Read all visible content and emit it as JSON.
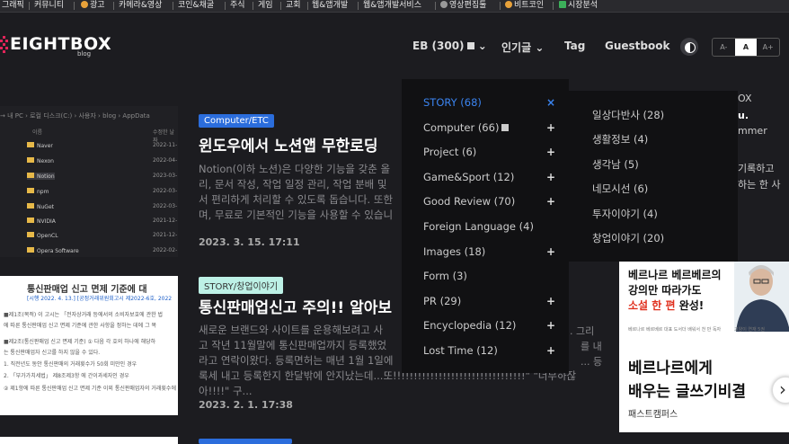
{
  "topbar": {
    "items": [
      "그래픽",
      "커뮤니티",
      "광고",
      "카메라&영상",
      "코인&채굴",
      "주식",
      "게임",
      "교회",
      "웹&앱개발",
      "웹&앱개발서비스",
      "영상편집툴",
      "비트코인",
      "시장분석"
    ]
  },
  "header": {
    "logo": "EIGHTBOX",
    "logo_sub": "blog",
    "nav": {
      "eb": "EB (300)",
      "popular": "인기글",
      "tag": "Tag",
      "guestbook": "Guestbook"
    },
    "font_size": [
      "A-",
      "A",
      "A+"
    ]
  },
  "thumb1": {
    "path": "→ 내 PC › 로컬 디스크(C:) › 사용자 › blog › AppData",
    "col_name": "이름",
    "col_date": "수정한 날짜",
    "folders": [
      {
        "name": "Naver",
        "date": "2022-11-"
      },
      {
        "name": "Nexon",
        "date": "2022-04-"
      },
      {
        "name": "Notion",
        "date": "2023-03-"
      },
      {
        "name": "npm",
        "date": "2022-03-"
      },
      {
        "name": "NuGet",
        "date": "2022-03-"
      },
      {
        "name": "NVIDIA",
        "date": "2021-12-"
      },
      {
        "name": "OpenCL",
        "date": "2021-12-"
      },
      {
        "name": "Opera Software",
        "date": "2022-02-"
      }
    ]
  },
  "thumb2": {
    "title": "통신판매업 신고 면제 기준에 대",
    "subtitle": "[시행 2022. 4. 13.] [공정거래위원회고시 제2022-6호, 2022",
    "lines": [
      "■제1조(목적) 이 고시는 「전자상거래 등에서의 소비자보호에 관한 법",
      "에 따른 통신판매업 신고 면제 기준에 관한 사항을 정하는 데에 그 목",
      "■제2조(통신판매업 신고 면제 기준) ① 다음 각 호의 하나에 해당하",
      "는 통신판매업자 신고를 하지 않을 수 있다.",
      "1. 직전년도 동안 통신판매의 거래횟수가 50회 미만인 경우",
      "2. 「부가가치세법」 제8조제3항 에 간이과세자인 경우",
      "② 제1항에 따른 통신판매업 신고 면제 기준 이외 통신판매업자의 거래횟수에 산정하"
    ]
  },
  "posts": [
    {
      "category": "Computer/ETC",
      "title": "윈도우에서 노션앱 무한로딩 ",
      "body_lines": [
        "Notion(이하 노션)은 다양한 기능을 갖춘 올",
        "리, 문서 작성, 작업 일정 관리, 작업 분배 및",
        "서 편리하게 처리할 수 있도록 돕습니다. 또한",
        "며, 무료로 기본적인 기능을 사용할 수 있습니"
      ],
      "date": "2023. 3. 15. 17:11"
    },
    {
      "category": "STORY/창업이야기",
      "title": "통신판매업신고 주의!! 알아보",
      "body_lines": [
        "새로운 브랜드와 사이트를 운용해보려고 사",
        "고 작년 11월말에 통신판매업까지 등록했었",
        "라고 연락이왔다. 등록면허는 매년 1월 1일에",
        "록세 내고 등록한지 한달밖에 안지났는데...또!!!!!!!!!!!!!!!!!!!!!!!!!!!!!!!!\" \"너무하잖아!!!!\" 구..."
      ],
      "body_right": [
        ". 그리",
        "를 내",
        "... 등"
      ],
      "date": "2023. 2. 1. 17:38"
    }
  ],
  "dropdown": {
    "items": [
      {
        "label": "STORY (68)",
        "toggle": "×",
        "active": true
      },
      {
        "label": "Computer (66)",
        "toggle": "+",
        "icon": true
      },
      {
        "label": "Project (6)",
        "toggle": "+"
      },
      {
        "label": "Game&Sport (12)",
        "toggle": "+"
      },
      {
        "label": "Good Review (70)",
        "toggle": "+"
      },
      {
        "label": "Foreign Language (4)",
        "toggle": ""
      },
      {
        "label": "Images (18)",
        "toggle": "+"
      },
      {
        "label": "Form (3)",
        "toggle": ""
      },
      {
        "label": "PR (29)",
        "toggle": "+"
      },
      {
        "label": "Encyclopedia (12)",
        "toggle": "+"
      },
      {
        "label": "Lost Time (12)",
        "toggle": "+"
      }
    ],
    "submenu": [
      "일상다반사 (28)",
      "생활정보 (4)",
      "생각남 (5)",
      "네모시선 (6)",
      "투자이야기 (4)",
      "창업이야기 (20)"
    ]
  },
  "side": {
    "frags": [
      "OX",
      "u.",
      "mmer",
      "기록하고",
      "하는 한 사"
    ]
  },
  "ad": {
    "line1": "베르나르 베르베르의",
    "line2": "강의만 따라가도",
    "line3_pre": "",
    "line3_red": "소설 한 편",
    "line3_post": " 완성!",
    "small": [
      "베르나르 베르베르 대표 도서",
      "더 배워서 천 만 독자",
      "고양이 연재 5권"
    ],
    "big1": "베르나르에게",
    "big2": "배우는 글쓰기비결",
    "brand": "패스트캠퍼스"
  },
  "colors": {
    "background": "#1c1c20",
    "accent_blue": "#2b6ddc",
    "dropdown_active": "#3b84f0",
    "logo_red": "#e1245a"
  }
}
